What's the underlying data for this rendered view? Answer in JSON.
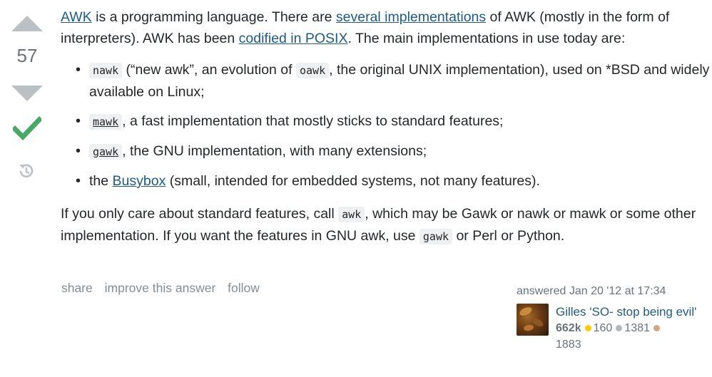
{
  "vote": {
    "count": "57"
  },
  "answer": {
    "intro": {
      "awk_link": "AWK",
      "t1": " is a programming language. There are ",
      "impl_link": "several implementations",
      "t2": " of AWK (mostly in the form of interpreters). AWK has been ",
      "posix_link": "codified in POSIX",
      "t3": ". The main implementations in use today are:"
    },
    "list": [
      {
        "code": "nawk",
        "t1": " (“new awk”, an evolution of ",
        "code2": "oawk",
        "t2": ", the original UNIX implementation), used on *BSD and widely available on Linux;"
      },
      {
        "code": "mawk",
        "t1": ", a fast implementation that mostly sticks to standard features;"
      },
      {
        "code": "gawk",
        "t1": ", the GNU implementation, with many extensions;"
      },
      {
        "t0": "the ",
        "link": "Busybox",
        "t1": " (small, intended for embedded systems, not many features)."
      }
    ],
    "outro": {
      "t1": "If you only care about standard features, call ",
      "code1": "awk",
      "t2": ", which may be Gawk or nawk or mawk or some other implementation. If you want the features in GNU awk, use ",
      "code2": "gawk",
      "t3": " or Perl or Python."
    }
  },
  "menu": {
    "share": "share",
    "improve": "improve this answer",
    "follow": "follow"
  },
  "user": {
    "action_time": "answered Jan 20 '12 at 17:34",
    "name": "Gilles 'SO- stop being evil'",
    "reputation": "662k",
    "gold": "160",
    "silver": "1381",
    "bronze": "1883"
  },
  "colors": {
    "link": "#1f5a86",
    "accepted": "#48a868",
    "gold": "#ffcc01",
    "silver": "#b4b8bc",
    "bronze": "#d1a684"
  },
  "icons": {
    "up": "vote-up-arrow-icon",
    "down": "vote-down-arrow-icon",
    "accepted": "checkmark-icon",
    "history": "history-icon"
  }
}
